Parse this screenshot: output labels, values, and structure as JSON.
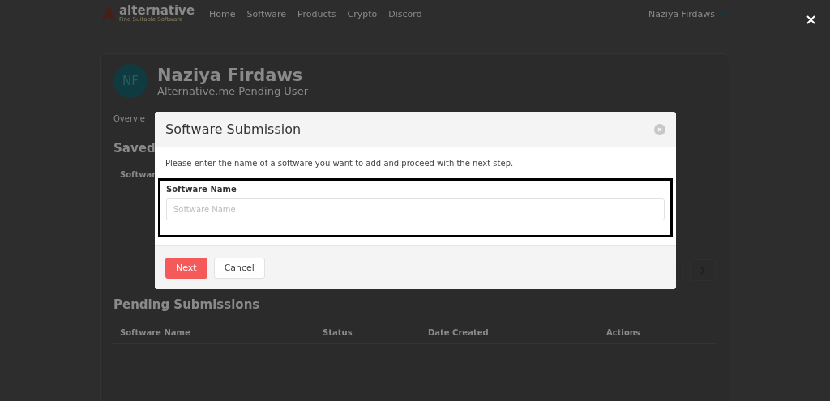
{
  "navbar": {
    "logo_name": "alternative",
    "logo_tagline": "Find Suitable Software",
    "links": [
      "Home",
      "Software",
      "Products",
      "Crypto",
      "Discord"
    ],
    "user": "Naziya Firdaws"
  },
  "profile": {
    "initials": "NF",
    "name": "Naziya Firdaws",
    "role": "Alternative.me Pending User"
  },
  "tabs": [
    {
      "label": "Overvie"
    }
  ],
  "saved": {
    "title": "Saved",
    "column": "Softwar"
  },
  "pending": {
    "title": "Pending Submissions",
    "columns": [
      "Software Name",
      "Status",
      "Date Created",
      "Actions"
    ]
  },
  "modal": {
    "title": "Software Submission",
    "instruction": "Please enter the name of a software you want to add and proceed with the next step.",
    "field_label": "Software Name",
    "placeholder": "Software Name",
    "buttons": [
      {
        "label": "Next",
        "kind": "primary"
      },
      {
        "label": "Cancel",
        "kind": "secondary"
      }
    ]
  }
}
